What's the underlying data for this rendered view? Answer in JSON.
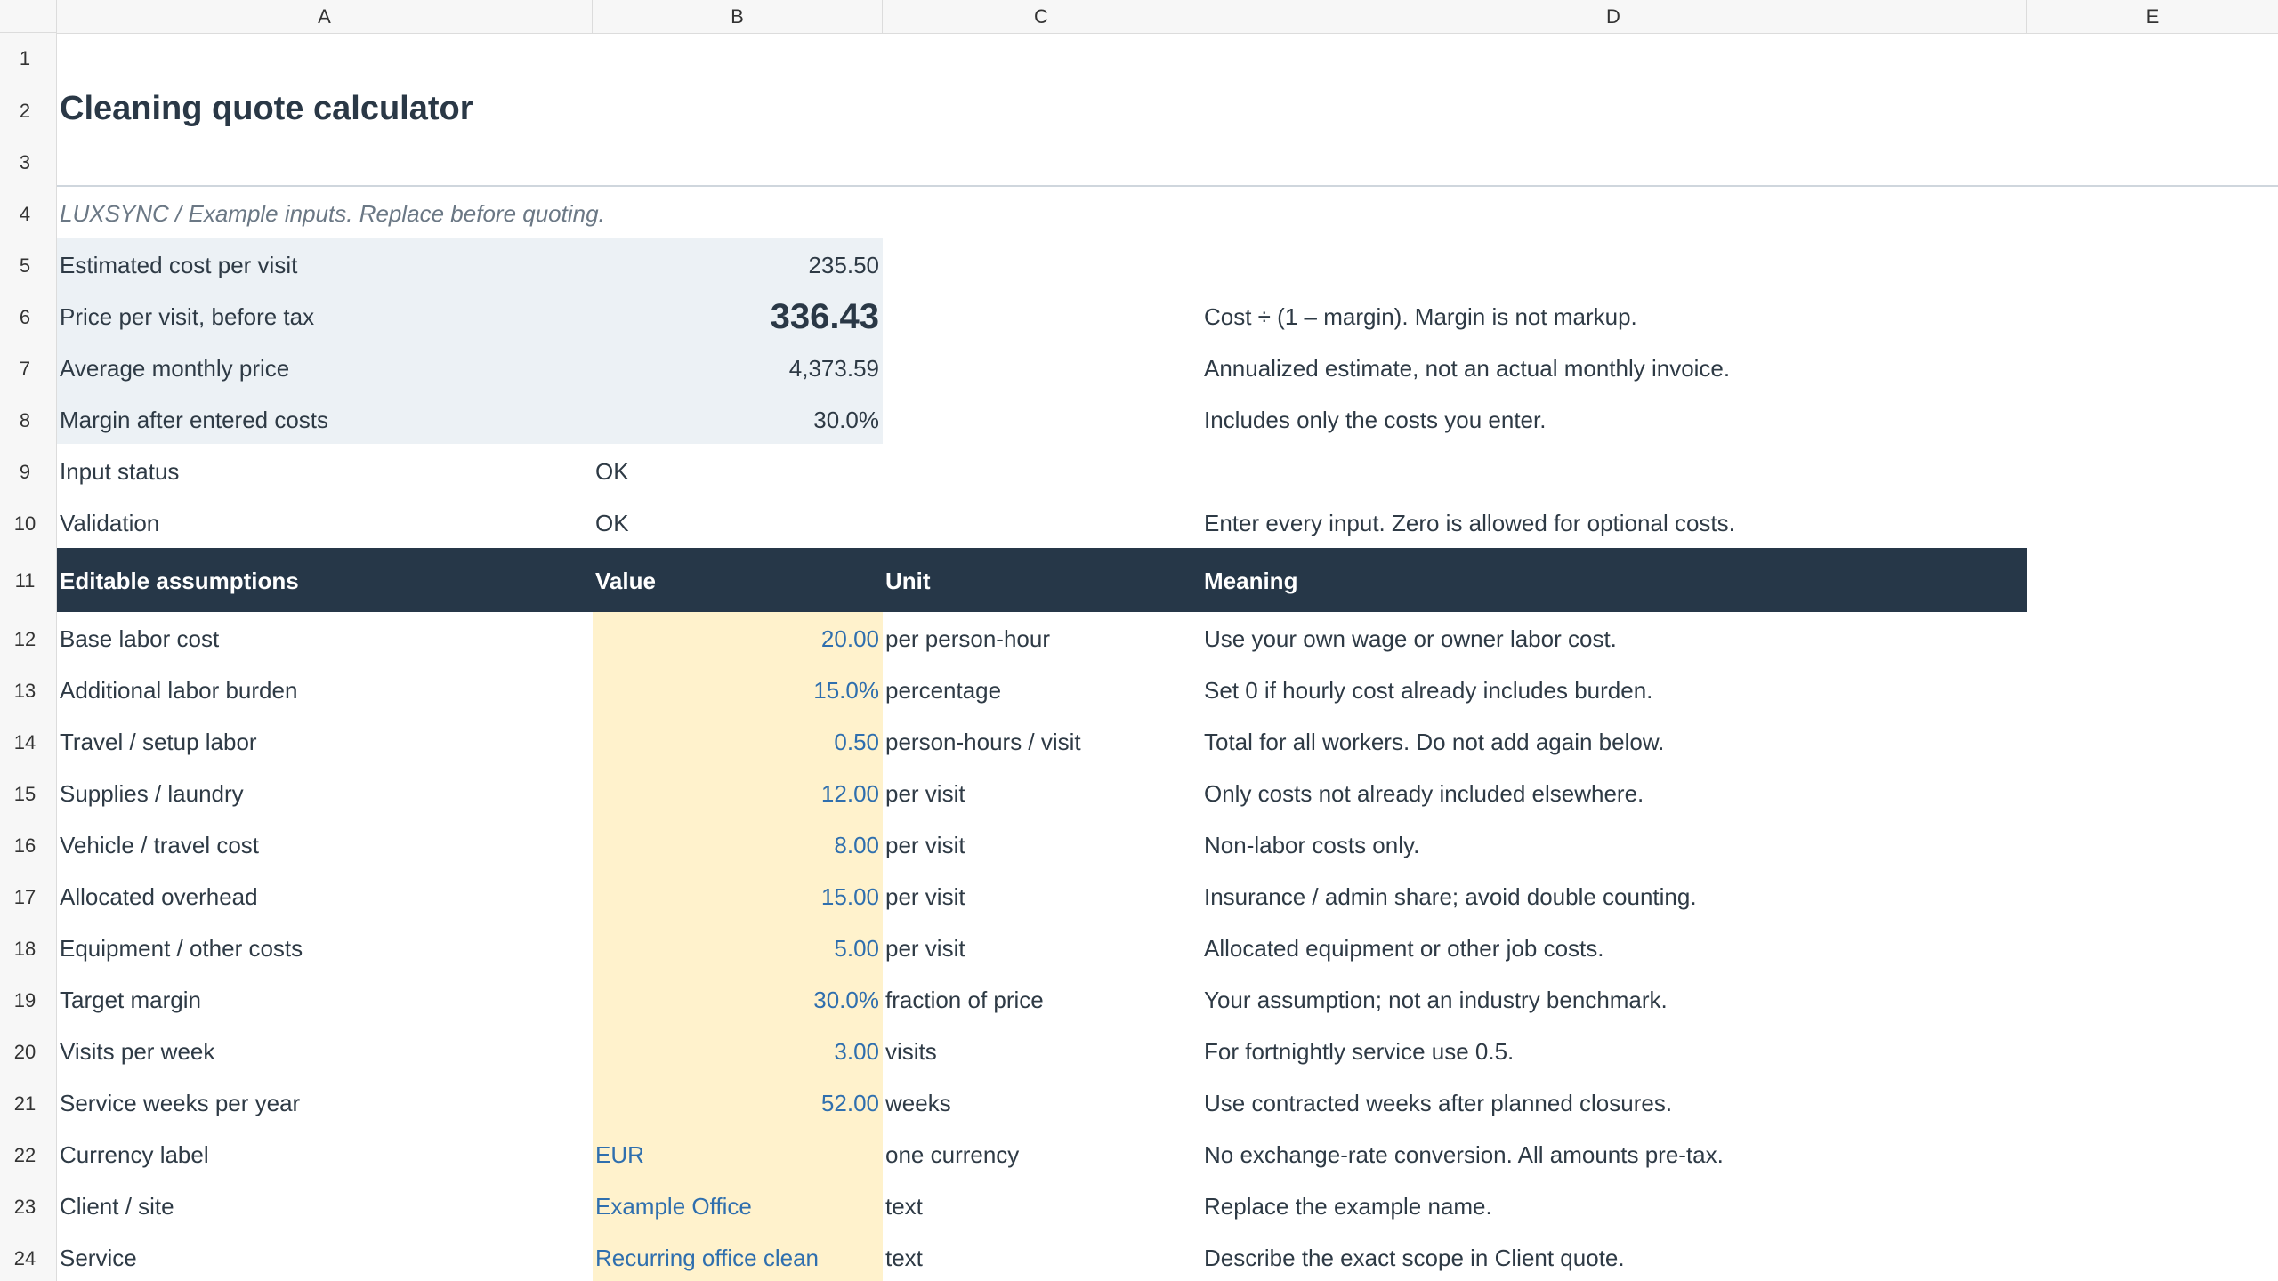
{
  "columns": [
    "A",
    "B",
    "C",
    "D",
    "E"
  ],
  "rows": [
    "1",
    "2",
    "3",
    "4",
    "5",
    "6",
    "7",
    "8",
    "9",
    "10",
    "11",
    "12",
    "13",
    "14",
    "15",
    "16",
    "17",
    "18",
    "19",
    "20",
    "21",
    "22",
    "23",
    "24"
  ],
  "title": "Cleaning quote calculator",
  "subtitle": "LUXSYNC  /  Example inputs. Replace before quoting.",
  "summary": [
    {
      "label": "Estimated cost per visit",
      "value": "235.50",
      "note": ""
    },
    {
      "label": "Price per visit, before tax",
      "value": "336.43",
      "note": "Cost ÷ (1 – margin). Margin is not markup."
    },
    {
      "label": "Average monthly price",
      "value": "4,373.59",
      "note": "Annualized estimate, not an actual monthly invoice."
    },
    {
      "label": "Margin after entered costs",
      "value": "30.0%",
      "note": "Includes only the costs you enter."
    }
  ],
  "status": [
    {
      "label": "Input status",
      "value": "OK",
      "note": ""
    },
    {
      "label": "Validation",
      "value": "OK",
      "note": "Enter every input. Zero is allowed for optional costs."
    }
  ],
  "table_header": {
    "a": "Editable assumptions",
    "b": "Value",
    "c": "Unit",
    "d": "Meaning"
  },
  "assumptions": [
    {
      "label": "Base labor cost",
      "value": "20.00",
      "unit": "per person-hour",
      "meaning": "Use your own wage or owner labor cost."
    },
    {
      "label": "Additional labor burden",
      "value": "15.0%",
      "unit": "percentage",
      "meaning": "Set 0 if hourly cost already includes burden."
    },
    {
      "label": "Travel / setup labor",
      "value": "0.50",
      "unit": "person-hours / visit",
      "meaning": "Total for all workers. Do not add again below."
    },
    {
      "label": "Supplies / laundry",
      "value": "12.00",
      "unit": "per visit",
      "meaning": "Only costs not already included elsewhere."
    },
    {
      "label": "Vehicle / travel cost",
      "value": "8.00",
      "unit": "per visit",
      "meaning": "Non-labor costs only."
    },
    {
      "label": "Allocated overhead",
      "value": "15.00",
      "unit": "per visit",
      "meaning": "Insurance / admin share; avoid double counting."
    },
    {
      "label": "Equipment / other costs",
      "value": "5.00",
      "unit": "per visit",
      "meaning": "Allocated equipment or other job costs."
    },
    {
      "label": "Target margin",
      "value": "30.0%",
      "unit": "fraction of price",
      "meaning": "Your assumption; not an industry benchmark."
    },
    {
      "label": "Visits per week",
      "value": "3.00",
      "unit": "visits",
      "meaning": "For fortnightly service use 0.5."
    },
    {
      "label": "Service weeks per year",
      "value": "52.00",
      "unit": "weeks",
      "meaning": "Use contracted weeks after planned closures."
    },
    {
      "label": "Currency label",
      "value": "EUR",
      "unit": "one currency",
      "meaning": "No exchange-rate conversion. All amounts pre-tax."
    },
    {
      "label": "Client / site",
      "value": "Example Office",
      "unit": "text",
      "meaning": "Replace the example name."
    },
    {
      "label": "Service",
      "value": "Recurring office clean",
      "unit": "text",
      "meaning": "Describe the exact scope in Client quote."
    }
  ],
  "colors": {
    "header_band": "#263748",
    "input_fill": "#fff2cc",
    "summary_fill": "#ecf1f5",
    "input_text": "#2f6fae"
  }
}
